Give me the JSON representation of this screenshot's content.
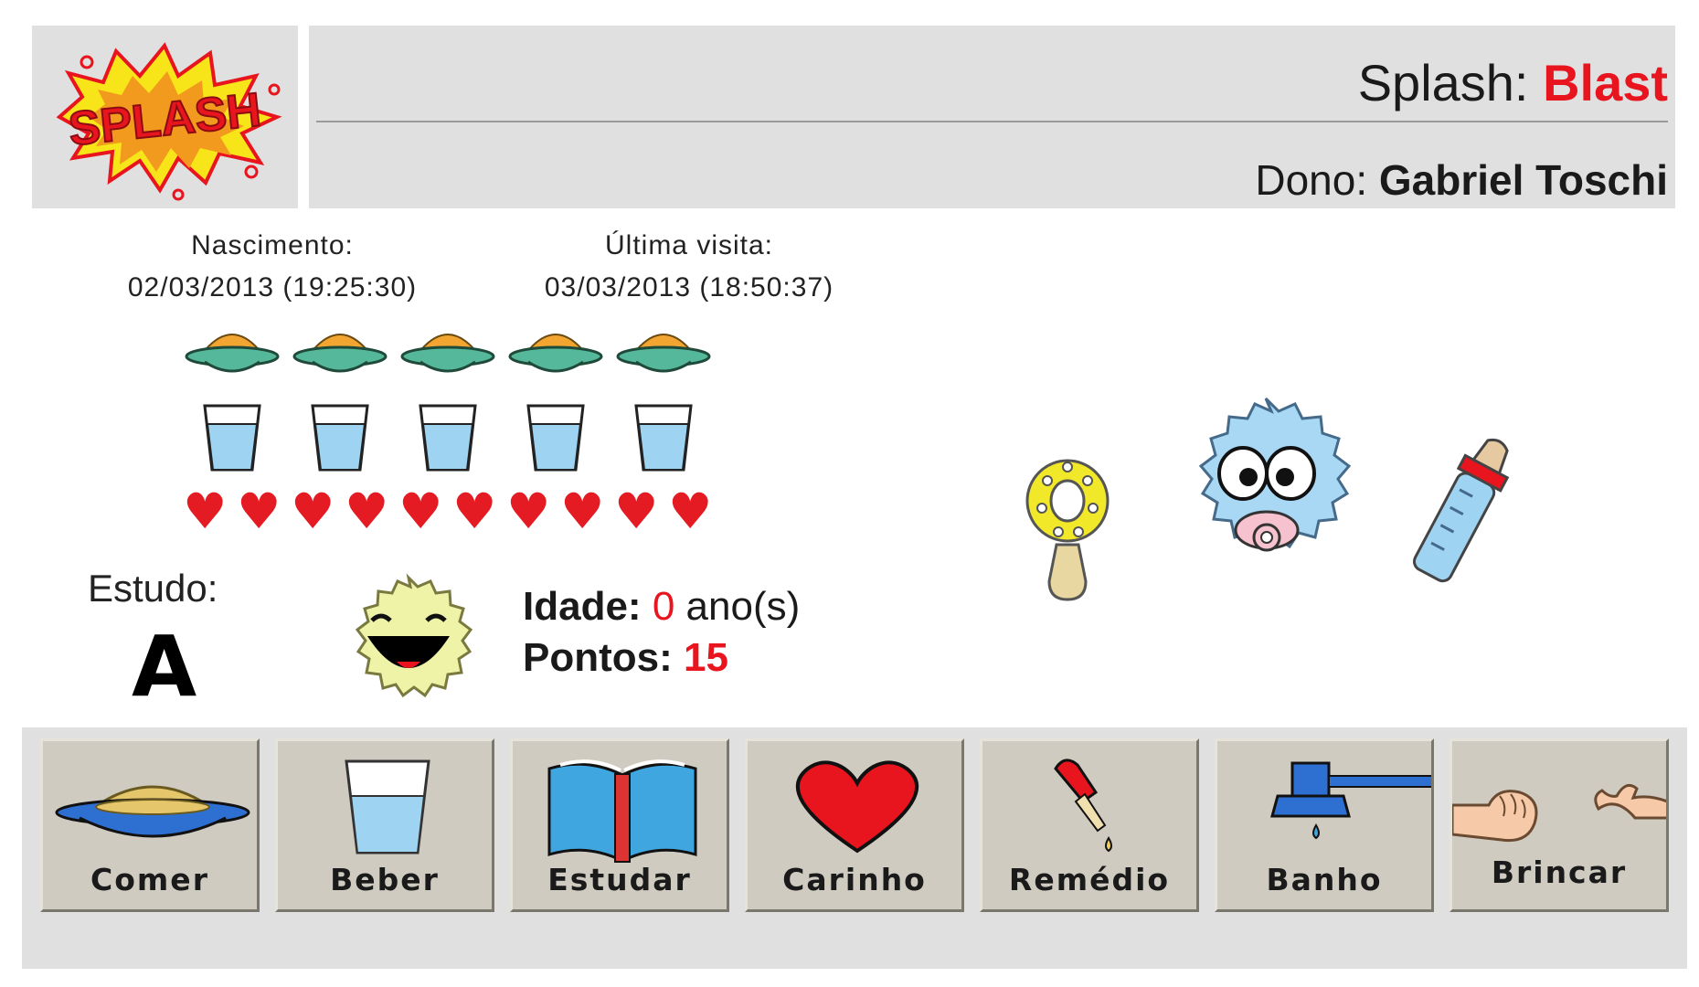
{
  "header": {
    "logo_text": "SPLASH",
    "pet_label": "Splash:",
    "pet_name": "Blast",
    "owner_label": "Dono:",
    "owner_name": "Gabriel Toschi"
  },
  "dates": {
    "birth_label": "Nascimento:",
    "birth_value": "02/03/2013 (19:25:30)",
    "visit_label": "Última visita:",
    "visit_value": "03/03/2013 (18:50:37)"
  },
  "status": {
    "food_level": 5,
    "drink_level": 5,
    "hearts": 10,
    "heart_glyph": "♥",
    "food_icon": "food-plate-icon",
    "drink_icon": "water-glass-icon"
  },
  "study": {
    "label": "Estudo:",
    "grade": "A"
  },
  "stats": {
    "age_label": "Idade:",
    "age_value": "0",
    "age_unit": "ano(s)",
    "points_label": "Pontos:",
    "points_value": "15"
  },
  "pet": {
    "mood": "happy",
    "stage": "baby",
    "items": [
      "rattle-icon",
      "baby-bottle-icon"
    ]
  },
  "actions": [
    {
      "label": "Comer",
      "icon": "food-plate-icon"
    },
    {
      "label": "Beber",
      "icon": "water-glass-icon"
    },
    {
      "label": "Estudar",
      "icon": "book-icon"
    },
    {
      "label": "Carinho",
      "icon": "heart-icon"
    },
    {
      "label": "Remédio",
      "icon": "dropper-icon"
    },
    {
      "label": "Banho",
      "icon": "shower-icon"
    },
    {
      "label": "Brincar",
      "icon": "hands-icon"
    }
  ],
  "colors": {
    "accent_red": "#e8141e",
    "panel_gray": "#e0e0e0",
    "button_face": "#cfcbc0",
    "water_blue": "#9fd3f2"
  }
}
